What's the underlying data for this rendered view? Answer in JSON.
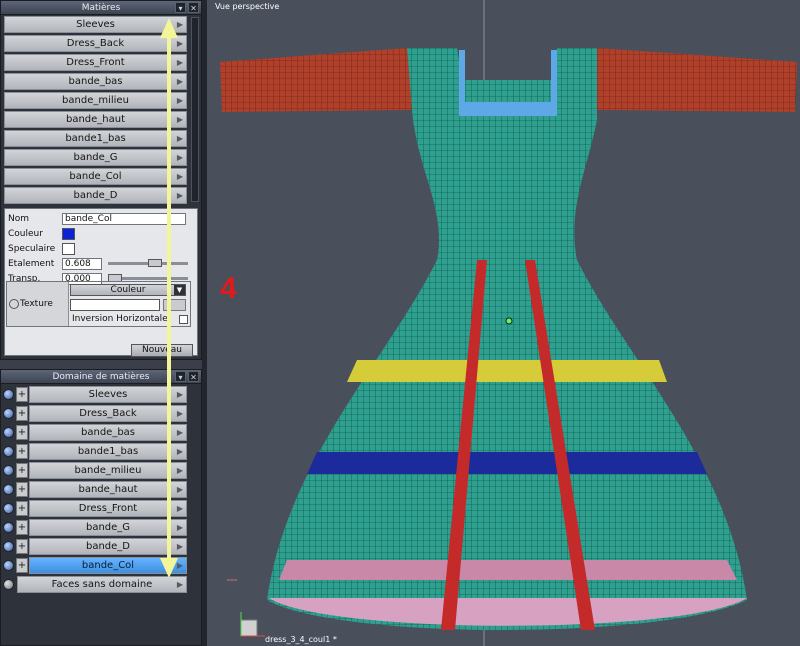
{
  "materials_panel": {
    "title": "Matières",
    "items": [
      "Sleeves",
      "Dress_Back",
      "Dress_Front",
      "bande_bas",
      "bande_milieu",
      "bande_haut",
      "bande1_bas",
      "bande_G",
      "bande_Col",
      "bande_D"
    ],
    "props": {
      "nom_label": "Nom",
      "nom_value": "bande_Col",
      "couleur_label": "Couleur",
      "couleur_color": "#0a22d8",
      "speculaire_label": "Speculaire",
      "speculaire_color": "#ffffff",
      "etalement_label": "Etalement",
      "etalement_value": "0.608",
      "transp_label": "Transp.",
      "transp_value": "0.000",
      "texture_label": "Texture",
      "texture_mode": "Couleur",
      "inversion_label": "Inversion Horizontale",
      "new_button": "Nouveau"
    }
  },
  "domain_panel": {
    "title": "Domaine de matières",
    "items": [
      "Sleeves",
      "Dress_Back",
      "bande_bas",
      "bande1_bas",
      "bande_milieu",
      "bande_haut",
      "Dress_Front",
      "bande_G",
      "bande_D",
      "bande_Col",
      "Faces sans domaine"
    ],
    "selected": "bande_Col"
  },
  "viewport": {
    "title": "Vue perspective",
    "filename": "dress_3_4_coul1 *",
    "annotation": "4"
  },
  "colors": {
    "selection": "#4da3f5",
    "annotation": "#e01b1b",
    "arrow": "#f3f59a"
  }
}
